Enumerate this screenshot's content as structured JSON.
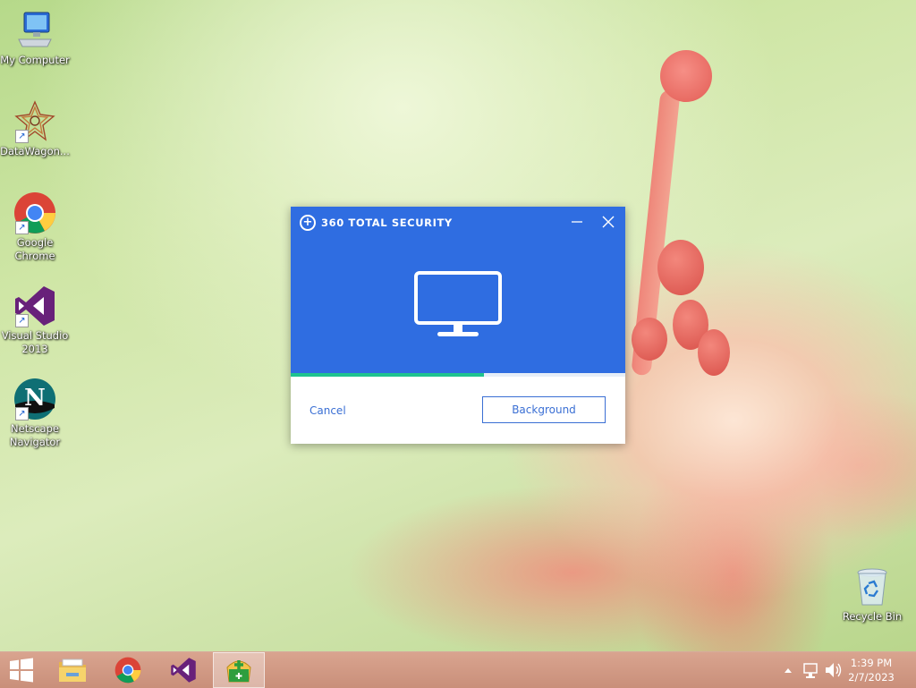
{
  "desktop": {
    "icons": [
      {
        "id": "my-computer",
        "label": "My Computer"
      },
      {
        "id": "datawagon",
        "label": "DataWagon..."
      },
      {
        "id": "google-chrome",
        "label": "Google Chrome"
      },
      {
        "id": "visual-studio",
        "label": "Visual Studio 2013"
      },
      {
        "id": "netscape",
        "label": "Netscape Navigator"
      },
      {
        "id": "recycle-bin",
        "label": "Recycle Bin"
      }
    ]
  },
  "dialog": {
    "title": "360 TOTAL SECURITY",
    "minimize_icon": "minimize-icon",
    "close_icon": "close-icon",
    "hero_icon": "monitor-icon",
    "progress": 0.577,
    "accent_color": "#2f6de1",
    "progress_color": "#1fc38f",
    "cancel_label": "Cancel",
    "background_label": "Background"
  },
  "taskbar": {
    "pinned": [
      "windows-start",
      "file-explorer",
      "google-chrome",
      "visual-studio",
      "360-total-security"
    ],
    "active": "360-total-security",
    "tray_icons": [
      "show-hidden-icons",
      "network-icon",
      "volume-icon"
    ],
    "time": "1:39 PM",
    "date": "2/7/2023"
  }
}
